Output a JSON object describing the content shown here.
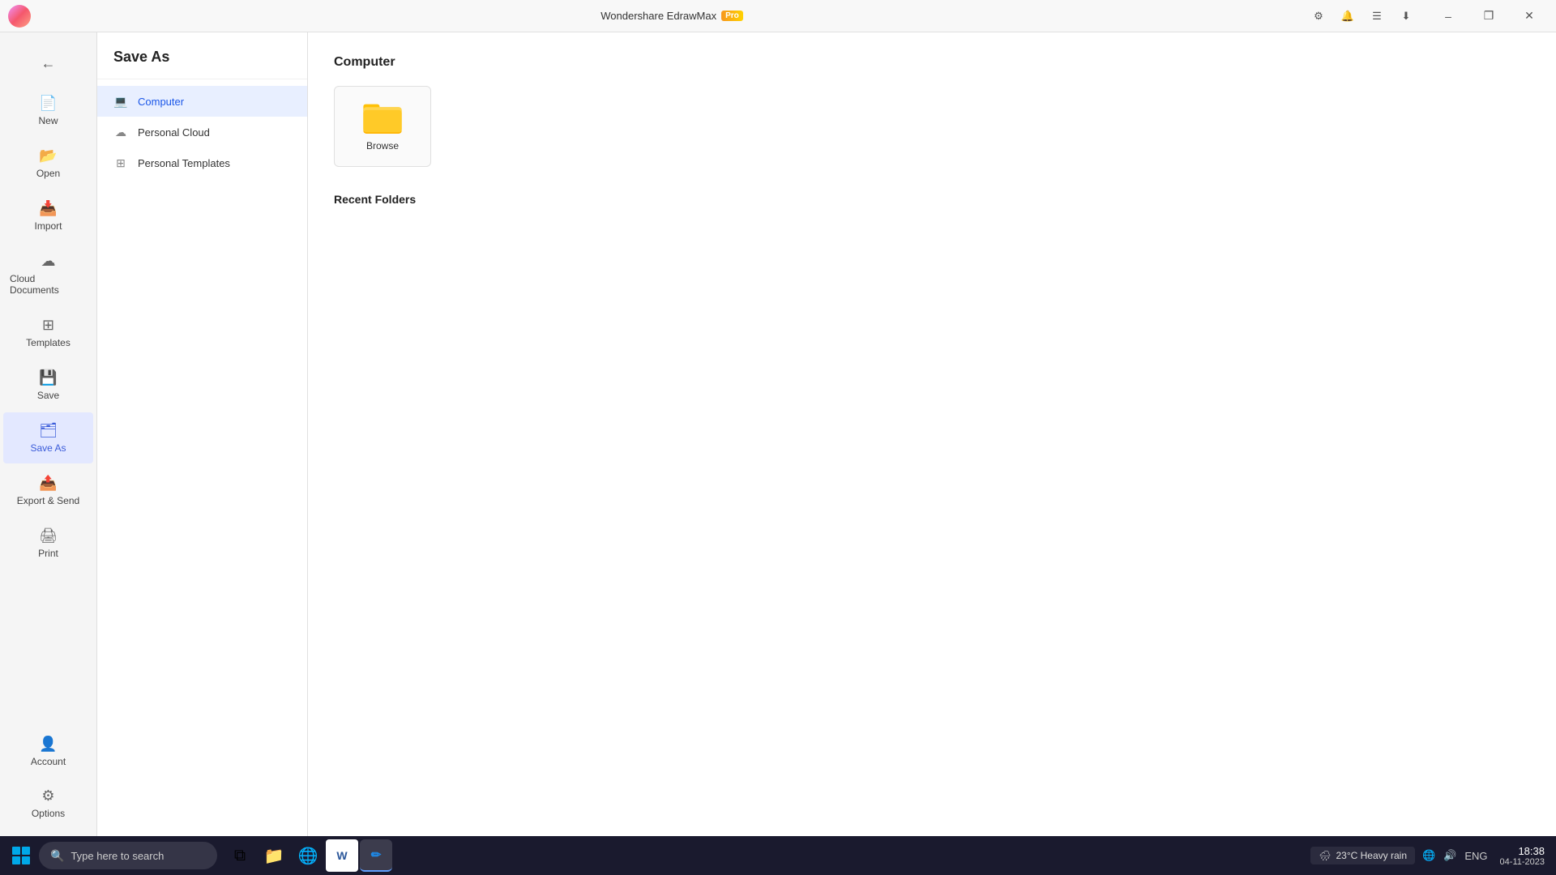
{
  "app": {
    "title": "Wondershare EdrawMax",
    "pro_label": "Pro"
  },
  "titlebar": {
    "minimize_label": "–",
    "restore_label": "❐",
    "close_label": "✕"
  },
  "toolbar": {
    "icon1": "⚙",
    "icon2": "🔔",
    "icon3": "☰",
    "icon4": "⬇"
  },
  "sidebar_left": {
    "back_label": "←",
    "items": [
      {
        "id": "new",
        "label": "New",
        "icon": "📄",
        "active": false
      },
      {
        "id": "open",
        "label": "Open",
        "icon": "📂",
        "active": false
      },
      {
        "id": "import",
        "label": "Import",
        "icon": "📥",
        "active": false
      },
      {
        "id": "cloud-documents",
        "label": "Cloud Documents",
        "icon": "☁",
        "active": false
      },
      {
        "id": "templates",
        "label": "Templates",
        "icon": "⊞",
        "active": false
      },
      {
        "id": "save",
        "label": "Save",
        "icon": "💾",
        "active": false
      },
      {
        "id": "save-as",
        "label": "Save As",
        "icon": "🗂",
        "active": true
      },
      {
        "id": "export-send",
        "label": "Export & Send",
        "icon": "📤",
        "active": false
      },
      {
        "id": "print",
        "label": "Print",
        "icon": "🖨",
        "active": false
      }
    ],
    "bottom_items": [
      {
        "id": "account",
        "label": "Account",
        "icon": "👤"
      },
      {
        "id": "options",
        "label": "Options",
        "icon": "⚙"
      }
    ]
  },
  "save_as_panel": {
    "title": "Save As",
    "options": [
      {
        "id": "computer",
        "label": "Computer",
        "icon": "💻",
        "active": true
      },
      {
        "id": "personal-cloud",
        "label": "Personal Cloud",
        "icon": "☁",
        "active": false
      },
      {
        "id": "personal-templates",
        "label": "Personal Templates",
        "icon": "⊞",
        "active": false
      }
    ]
  },
  "main_content": {
    "section_title": "Computer",
    "browse_card_label": "Browse",
    "recent_folders_title": "Recent Folders"
  },
  "taskbar": {
    "search_placeholder": "Type here to search",
    "weather_temp": "23°C",
    "weather_desc": "Heavy rain",
    "clock_time": "18:38",
    "clock_date": "04-11-2023",
    "lang": "ENG",
    "apps": [
      {
        "id": "start",
        "icon": "⊞"
      },
      {
        "id": "search",
        "icon": "🔍"
      },
      {
        "id": "task-view",
        "icon": "⧉"
      },
      {
        "id": "file-explorer",
        "icon": "📁"
      },
      {
        "id": "chrome",
        "icon": "🌐"
      },
      {
        "id": "word",
        "icon": "W"
      },
      {
        "id": "edrawmax",
        "icon": "✏"
      }
    ]
  }
}
